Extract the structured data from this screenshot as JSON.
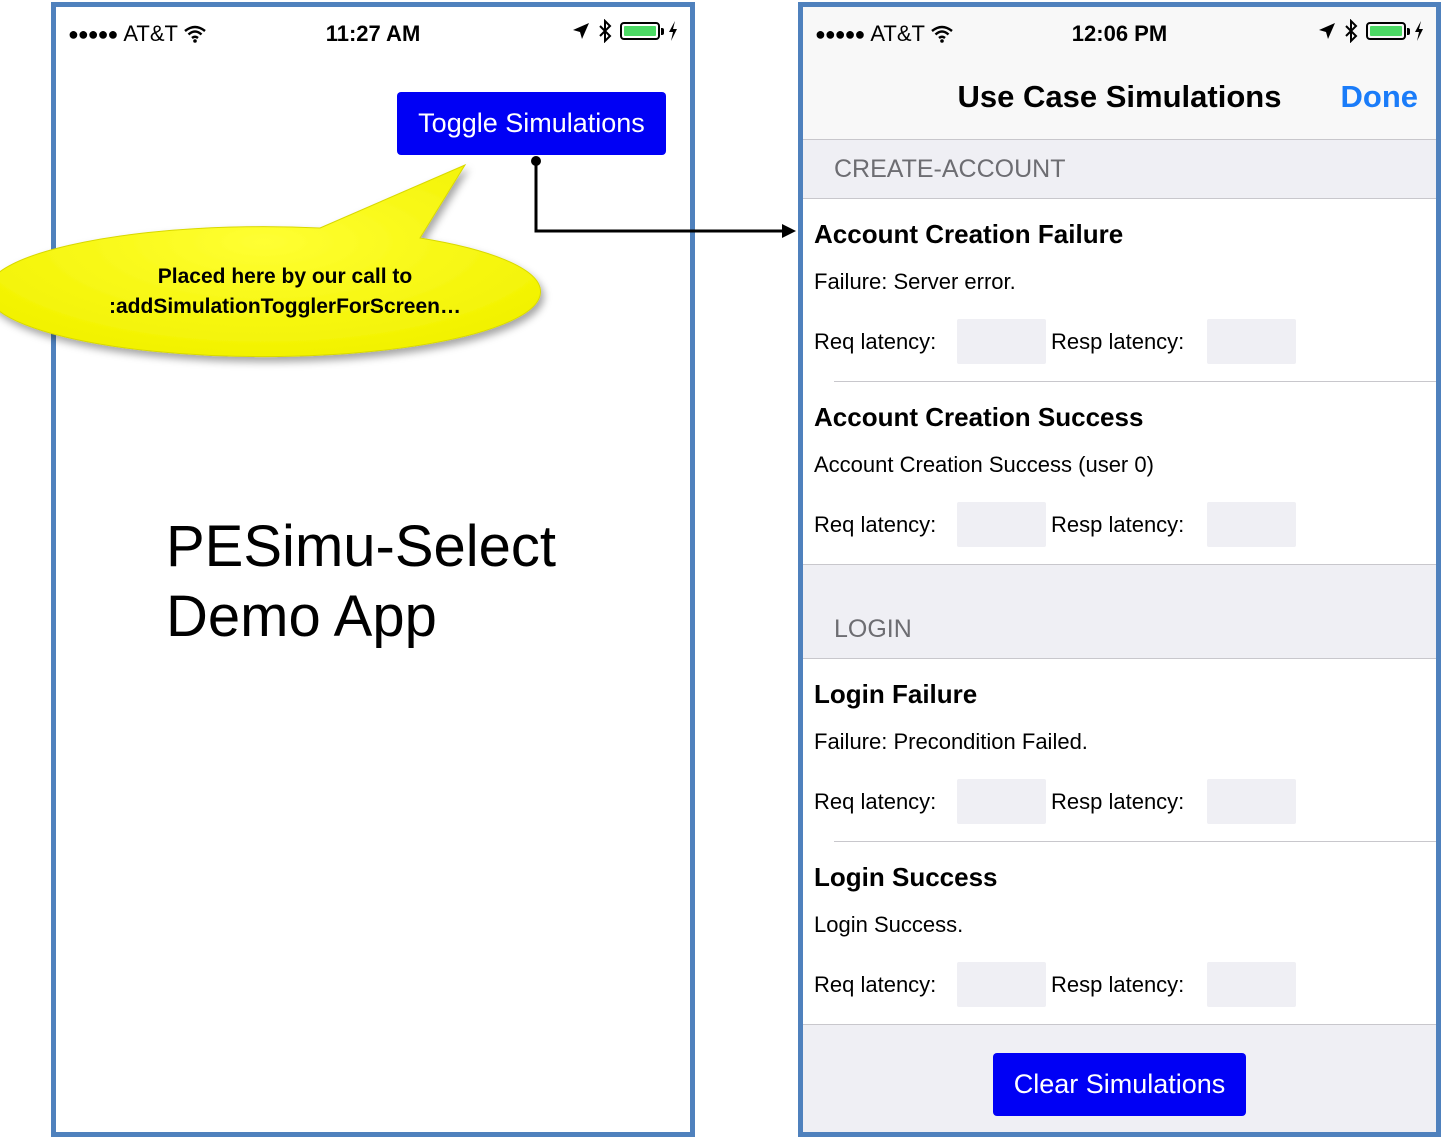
{
  "left_phone": {
    "status": {
      "carrier": "AT&T",
      "time": "11:27 AM"
    },
    "toggle_button": "Toggle Simulations",
    "app_title_line1": "PESimu-Select",
    "app_title_line2": "Demo App"
  },
  "annotation": {
    "line1": "Placed here by our call to",
    "line2": ":addSimulationTogglerForScreen…"
  },
  "right_phone": {
    "status": {
      "carrier": "AT&T",
      "time": "12:06 PM"
    },
    "nav_title": "Use Case Simulations",
    "done_label": "Done",
    "req_label": "Req latency:",
    "resp_label": "Resp latency:",
    "sections": [
      {
        "header": "CREATE-ACCOUNT",
        "cells": [
          {
            "title": "Account Creation Failure",
            "subtitle": "Failure: Server error."
          },
          {
            "title": "Account Creation Success",
            "subtitle": "Account Creation Success (user 0)"
          }
        ]
      },
      {
        "header": "LOGIN",
        "cells": [
          {
            "title": "Login Failure",
            "subtitle": "Failure: Precondition Failed."
          },
          {
            "title": "Login Success",
            "subtitle": "Login Success."
          }
        ]
      }
    ],
    "clear_button": "Clear Simulations"
  },
  "colors": {
    "frame": "#4f81bd",
    "button_blue": "#0000f5",
    "ios_tint": "#1a7cf9",
    "bubble_yellow": "#ffff00",
    "battery_green": "#4cd964"
  },
  "icons": [
    "signal-dots-icon",
    "wifi-icon",
    "location-arrow-icon",
    "bluetooth-icon",
    "battery-icon",
    "charging-bolt-icon"
  ]
}
